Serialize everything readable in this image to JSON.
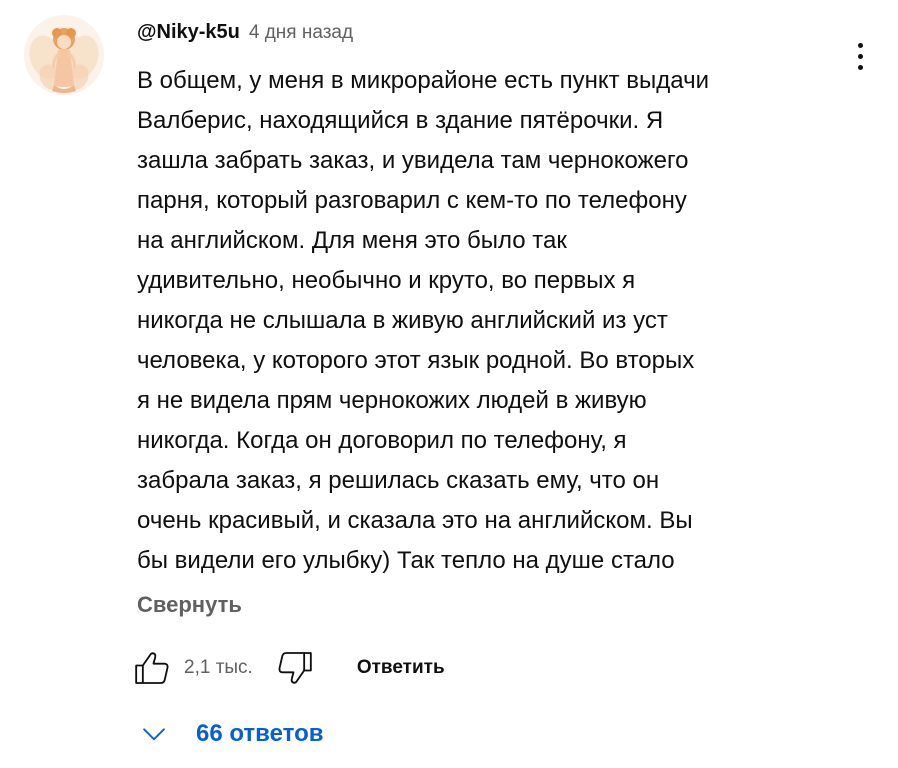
{
  "comment": {
    "author": "@Niky-k5u",
    "timestamp": "4 дня назад",
    "text": "В общем, у меня в микрорайоне есть пункт выдачи\nВалберис, находящийся в здание пятёрочки. Я\nзашла забрать заказ, и увидела там чернокожего\nпарня, который разговарил с кем-то по телефону\nна английском. Для меня это было так\nудивительно, необычно и круто, во первых я\nникогда не слышала в живую английский из уст\nчеловека, у которого этот язык родной. Во вторых\nя не видела прям чернокожих людей в живую\nникогда. Когда он договорил по телефону, я\nзабрала заказ, я решилась сказать ему, что он\nочень красивый, и сказала это на английском. Вы\nбы видели его улыбку) Так тепло на душе стало",
    "collapse_label": "Свернуть",
    "menu_icon": "more-vertical-icon"
  },
  "actions": {
    "like_icon": "thumbs-up-icon",
    "like_count": "2,1 тыс.",
    "dislike_icon": "thumbs-down-icon",
    "reply_label": "Ответить"
  },
  "replies": {
    "toggle_icon": "chevron-down-icon",
    "label": "66 ответов"
  },
  "colors": {
    "text": "#0f0f0f",
    "secondary_text": "#606060",
    "link_blue": "#065fd4",
    "background": "#ffffff"
  }
}
